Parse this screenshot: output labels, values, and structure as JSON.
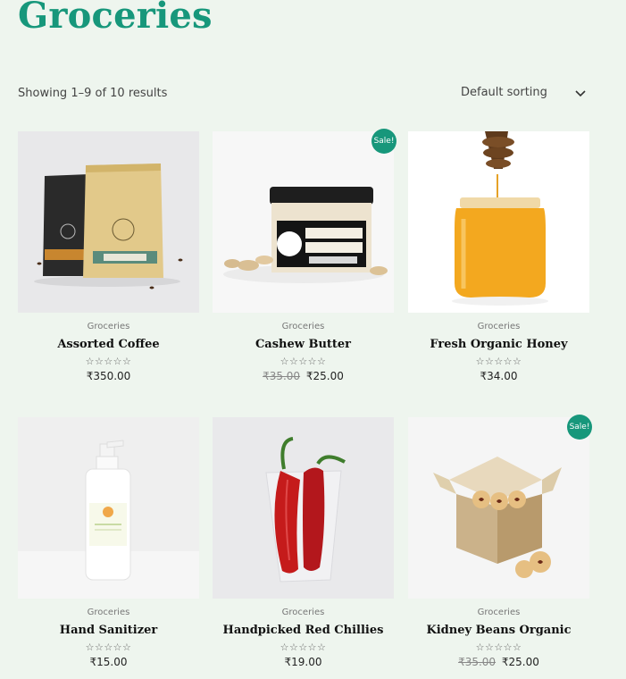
{
  "page": {
    "title": "Groceries"
  },
  "toolbar": {
    "result_count": "Showing 1–9 of 10 results",
    "sort_selected": "Default sorting"
  },
  "colors": {
    "accent": "#17977b",
    "background": "#eef5ee"
  },
  "stars": "☆☆☆☆☆",
  "products": [
    {
      "category": "Groceries",
      "name": "Assorted Coffee",
      "old_price": "",
      "price": "₹350.00",
      "sale": ""
    },
    {
      "category": "Groceries",
      "name": "Cashew Butter",
      "old_price": "₹35.00",
      "price": "₹25.00",
      "sale": "Sale!"
    },
    {
      "category": "Groceries",
      "name": "Fresh Organic Honey",
      "old_price": "",
      "price": "₹34.00",
      "sale": ""
    },
    {
      "category": "Groceries",
      "name": "Hand Sanitizer",
      "old_price": "",
      "price": "₹15.00",
      "sale": ""
    },
    {
      "category": "Groceries",
      "name": "Handpicked Red Chillies",
      "old_price": "",
      "price": "₹19.00",
      "sale": ""
    },
    {
      "category": "Groceries",
      "name": "Kidney Beans Organic",
      "old_price": "₹35.00",
      "price": "₹25.00",
      "sale": "Sale!"
    }
  ]
}
